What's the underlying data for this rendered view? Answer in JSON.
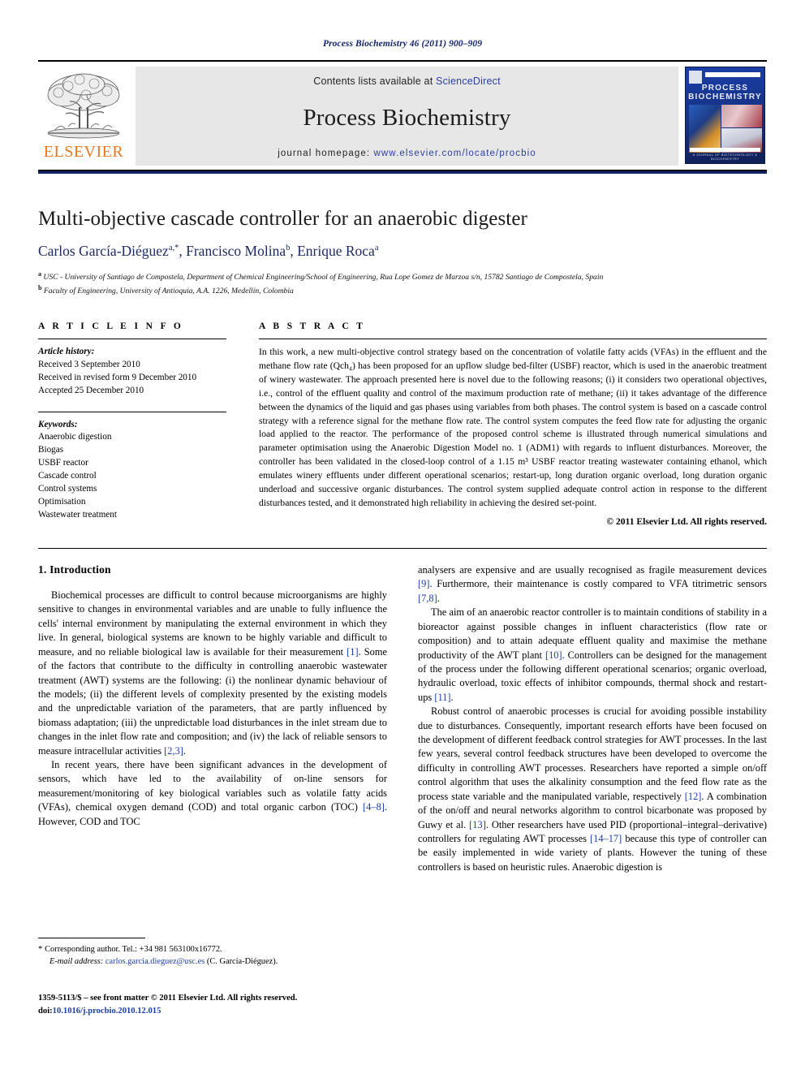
{
  "running_head": "Process Biochemistry 46 (2011) 900–909",
  "masthead": {
    "publisher_name": "ELSEVIER",
    "contents_prefix": "Contents lists available at ",
    "contents_link": "ScienceDirect",
    "journal_title": "Process Biochemistry",
    "homepage_prefix": "journal homepage: ",
    "homepage_url": "www.elsevier.com/locate/procbio",
    "cover_title_line1": "PROCESS",
    "cover_title_line2": "BIOCHEMISTRY",
    "cover_footer": "A JOURNAL OF BIOTECHNOLOGY & BIOCHEMISTRY",
    "accent_orange": "#e87722",
    "accent_blue": "#2b3f9e",
    "rule_blue": "#12236b"
  },
  "article": {
    "title": "Multi-objective cascade controller for an anaerobic digester",
    "authors_html": "Carlos García-Diéguez<sup>a,*</sup>, Francisco Molina<sup>b</sup>, Enrique Roca<sup>a</sup>",
    "affiliation_a": "USC - University of Santiago de Compostela, Department of Chemical Engineering/School of Engineering, Rua Lope Gomez de Marzoa s/n, 15782 Santiago de Compostela, Spain",
    "affiliation_b": "Faculty of Engineering, University of Antioquia, A.A. 1226, Medellín, Colombia"
  },
  "article_info": {
    "heading": "A R T I C L E  I N F O",
    "history_label": "Article history:",
    "history": [
      "Received 3 September 2010",
      "Received in revised form 9 December 2010",
      "Accepted 25 December 2010"
    ],
    "keywords_label": "Keywords:",
    "keywords": [
      "Anaerobic digestion",
      "Biogas",
      "USBF reactor",
      "Cascade control",
      "Control systems",
      "Optimisation",
      "Wastewater treatment"
    ]
  },
  "abstract": {
    "heading": "A B S T R A C T",
    "text": "In this work, a new multi-objective control strategy based on the concentration of volatile fatty acids (VFAs) in the effluent and the methane flow rate (Qch₄) has been proposed for an upflow sludge bed-filter (USBF) reactor, which is used in the anaerobic treatment of winery wastewater. The approach presented here is novel due to the following reasons; (i) it considers two operational objectives, i.e., control of the effluent quality and control of the maximum production rate of methane; (ii) it takes advantage of the difference between the dynamics of the liquid and gas phases using variables from both phases. The control system is based on a cascade control strategy with a reference signal for the methane flow rate. The control system computes the feed flow rate for adjusting the organic load applied to the reactor. The performance of the proposed control scheme is illustrated through numerical simulations and parameter optimisation using the Anaerobic Digestion Model no. 1 (ADM1) with regards to influent disturbances. Moreover, the controller has been validated in the closed-loop control of a 1.15 m³ USBF reactor treating wastewater containing ethanol, which emulates winery effluents under different operational scenarios; restart-up, long duration organic overload, long duration organic underload and successive organic disturbances. The control system supplied adequate control action in response to the different disturbances tested, and it demonstrated high reliability in achieving the desired set-point.",
    "copyright": "© 2011 Elsevier Ltd. All rights reserved."
  },
  "introduction": {
    "section_number_title": "1.  Introduction",
    "left_paragraph_1": "Biochemical processes are difficult to control because microorganisms are highly sensitive to changes in environmental variables and are unable to fully influence the cells' internal environment by manipulating the external environment in which they live. In general, biological systems are known to be highly variable and difficult to measure, and no reliable biological law is available for their measurement [1]. Some of the factors that contribute to the difficulty in controlling anaerobic wastewater treatment (AWT) systems are the following: (i) the nonlinear dynamic behaviour of the models; (ii) the different levels of complexity presented by the existing models and the unpredictable variation of the parameters, that are partly influenced by biomass adaptation; (iii) the unpredictable load disturbances in the inlet stream due to changes in the inlet flow rate and composition; and (iv) the lack of reliable sensors to measure intracellular activities [2,3].",
    "left_paragraph_2": "In recent years, there have been significant advances in the development of sensors, which have led to the availability of on-line sensors for measurement/monitoring of key biological variables such as volatile fatty acids (VFAs), chemical oxygen demand (COD) and total organic carbon (TOC) [4–8]. However, COD and TOC",
    "right_paragraph_1": "analysers are expensive and are usually recognised as fragile measurement devices [9]. Furthermore, their maintenance is costly compared to VFA titrimetric sensors [7,8].",
    "right_paragraph_2": "The aim of an anaerobic reactor controller is to maintain conditions of stability in a bioreactor against possible changes in influent characteristics (flow rate or composition) and to attain adequate effluent quality and maximise the methane productivity of the AWT plant [10]. Controllers can be designed for the management of the process under the following different operational scenarios; organic overload, hydraulic overload, toxic effects of inhibitor compounds, thermal shock and restart-ups [11].",
    "right_paragraph_3": "Robust control of anaerobic processes is crucial for avoiding possible instability due to disturbances. Consequently, important research efforts have been focused on the development of different feedback control strategies for AWT processes. In the last few years, several control feedback structures have been developed to overcome the difficulty in controlling AWT processes. Researchers have reported a simple on/off control algorithm that uses the alkalinity consumption and the feed flow rate as the process state variable and the manipulated variable, respectively [12]. A combination of the on/off and neural networks algorithm to control bicarbonate was proposed by Guwy et al. [13]. Other researchers have used PID (proportional–integral–derivative) controllers for regulating AWT processes [14–17] because this type of controller can be easily implemented in wide variety of plants. However the tuning of these controllers is based on heuristic rules. Anaerobic digestion is"
  },
  "footnotes": {
    "corresponding_marker": "*",
    "corresponding_text": "Corresponding author. Tel.: +34 981 563100x16772.",
    "email_label": "E-mail address:",
    "email": "carlos.garcia.dieguez@usc.es",
    "email_owner": "(C. García-Diéguez).",
    "issn_line": "1359-5113/$ – see front matter © 2011 Elsevier Ltd. All rights reserved.",
    "doi_label": "doi:",
    "doi_value": "10.1016/j.procbio.2010.12.015"
  }
}
